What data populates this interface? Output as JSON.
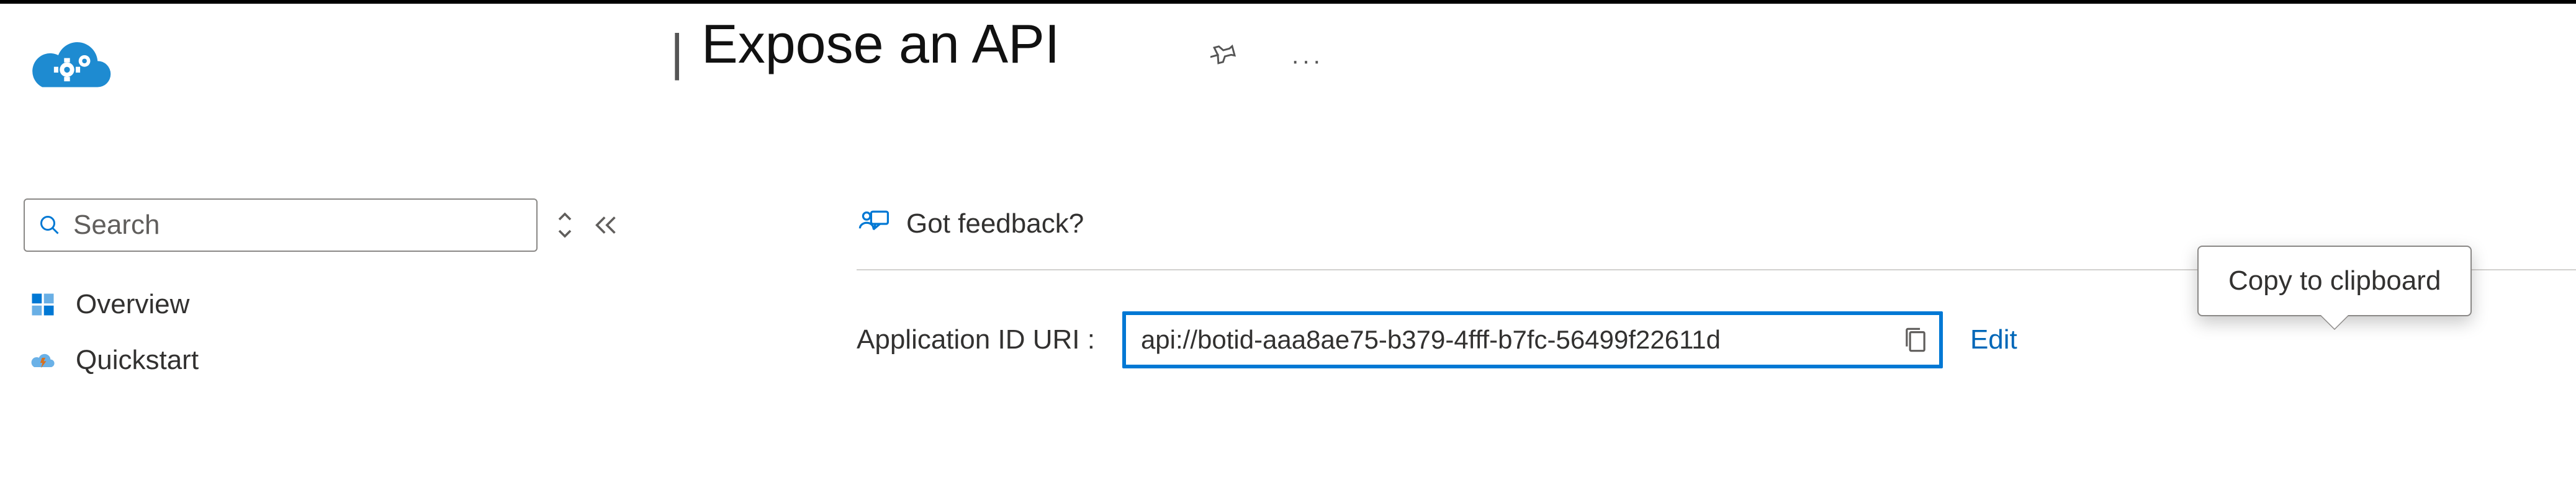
{
  "header": {
    "separator": "|",
    "title": "Expose an API"
  },
  "sidebar": {
    "search_placeholder": "Search",
    "nav": {
      "overview": "Overview",
      "quickstart": "Quickstart"
    }
  },
  "content": {
    "feedback_label": "Got feedback?",
    "app_id_label": "Application ID URI :",
    "app_id_value": "api://botid-aaa8ae75-b379-4fff-b7fc-56499f22611d",
    "edit_label": "Edit"
  },
  "tooltip": {
    "copy_label": "Copy to clipboard"
  }
}
